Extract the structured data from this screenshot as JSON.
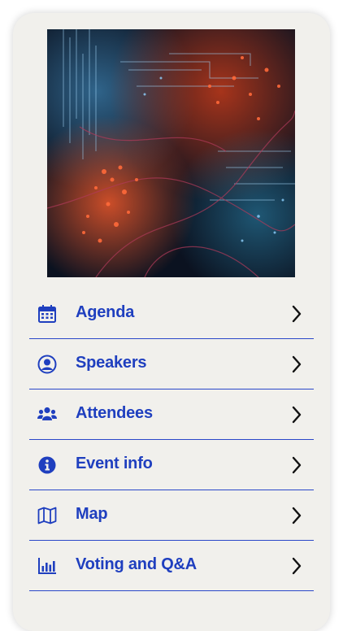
{
  "colors": {
    "card_background": "#f1f0ec",
    "accent": "#1f3fbf",
    "divider": "#2a47c9",
    "chevron": "#111111"
  },
  "hero": {
    "icon": "abstract-neon-network-image"
  },
  "menu": {
    "items": [
      {
        "label": "Agenda",
        "icon": "calendar-icon"
      },
      {
        "label": "Speakers",
        "icon": "user-circle-icon"
      },
      {
        "label": "Attendees",
        "icon": "users-icon"
      },
      {
        "label": "Event info",
        "icon": "info-icon"
      },
      {
        "label": "Map",
        "icon": "map-icon"
      },
      {
        "label": "Voting and Q&A",
        "icon": "poll-icon"
      }
    ]
  }
}
